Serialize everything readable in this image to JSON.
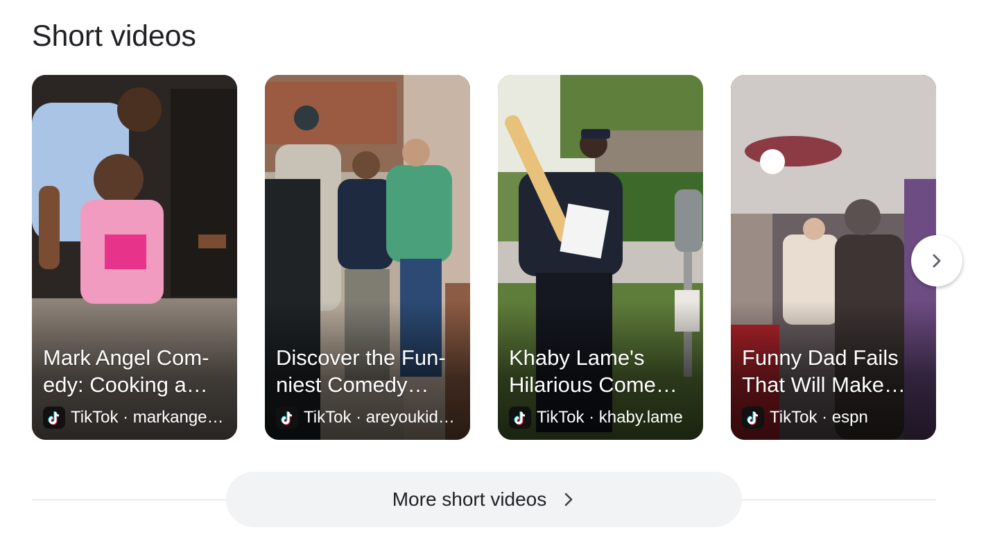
{
  "section": {
    "title": "Short videos"
  },
  "videos": [
    {
      "title": "Mark Angel Com-edy: Cooking a…",
      "platform": "TikTok",
      "separator": "·",
      "account": "markange…"
    },
    {
      "title": "Discover the Fun-niest Comedy…",
      "platform": "TikTok",
      "separator": "·",
      "account": "areyoukid…"
    },
    {
      "title": "Khaby Lame's Hilarious Come…",
      "platform": "TikTok",
      "separator": "·",
      "account": "khaby.lame"
    },
    {
      "title": "Funny Dad Fails That Will Make…",
      "platform": "TikTok",
      "separator": "·",
      "account": "espn"
    }
  ],
  "more_button": {
    "label": "More short videos"
  },
  "icons": {
    "source": "tiktok-icon",
    "next": "chevron-right-icon",
    "more": "chevron-right-icon"
  },
  "colors": {
    "tiktok_cyan": "#25F4EE",
    "tiktok_red": "#FE2C55",
    "button_bg": "#f1f3f4",
    "divider": "#dadce0"
  }
}
